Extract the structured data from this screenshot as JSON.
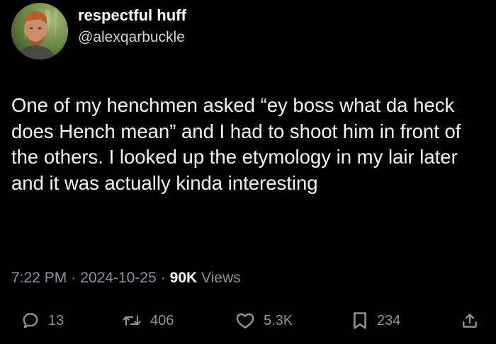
{
  "author": {
    "display_name": "respectful huff",
    "handle": "@alexqarbuckle"
  },
  "tweet": {
    "text": "One of my henchmen asked “ey boss what da heck does Hench mean” and I had to shoot him in front of the others. I looked up the etymology in my lair later and it was actually kinda interesting"
  },
  "meta": {
    "time": "7:22 PM",
    "separator": "·",
    "date": "2024-10-25",
    "views_count": "90K",
    "views_label": "Views"
  },
  "actions": {
    "replies": "13",
    "retweets": "406",
    "likes": "5.3K",
    "bookmarks": "234"
  },
  "icons": {
    "reply": "reply-bubble-icon",
    "retweet": "retweet-arrows-icon",
    "like": "heart-icon",
    "bookmark": "bookmark-icon",
    "share": "share-upload-icon"
  },
  "colors": {
    "background": "#000000",
    "text": "#e7e9ea",
    "secondary": "#8b9399"
  }
}
